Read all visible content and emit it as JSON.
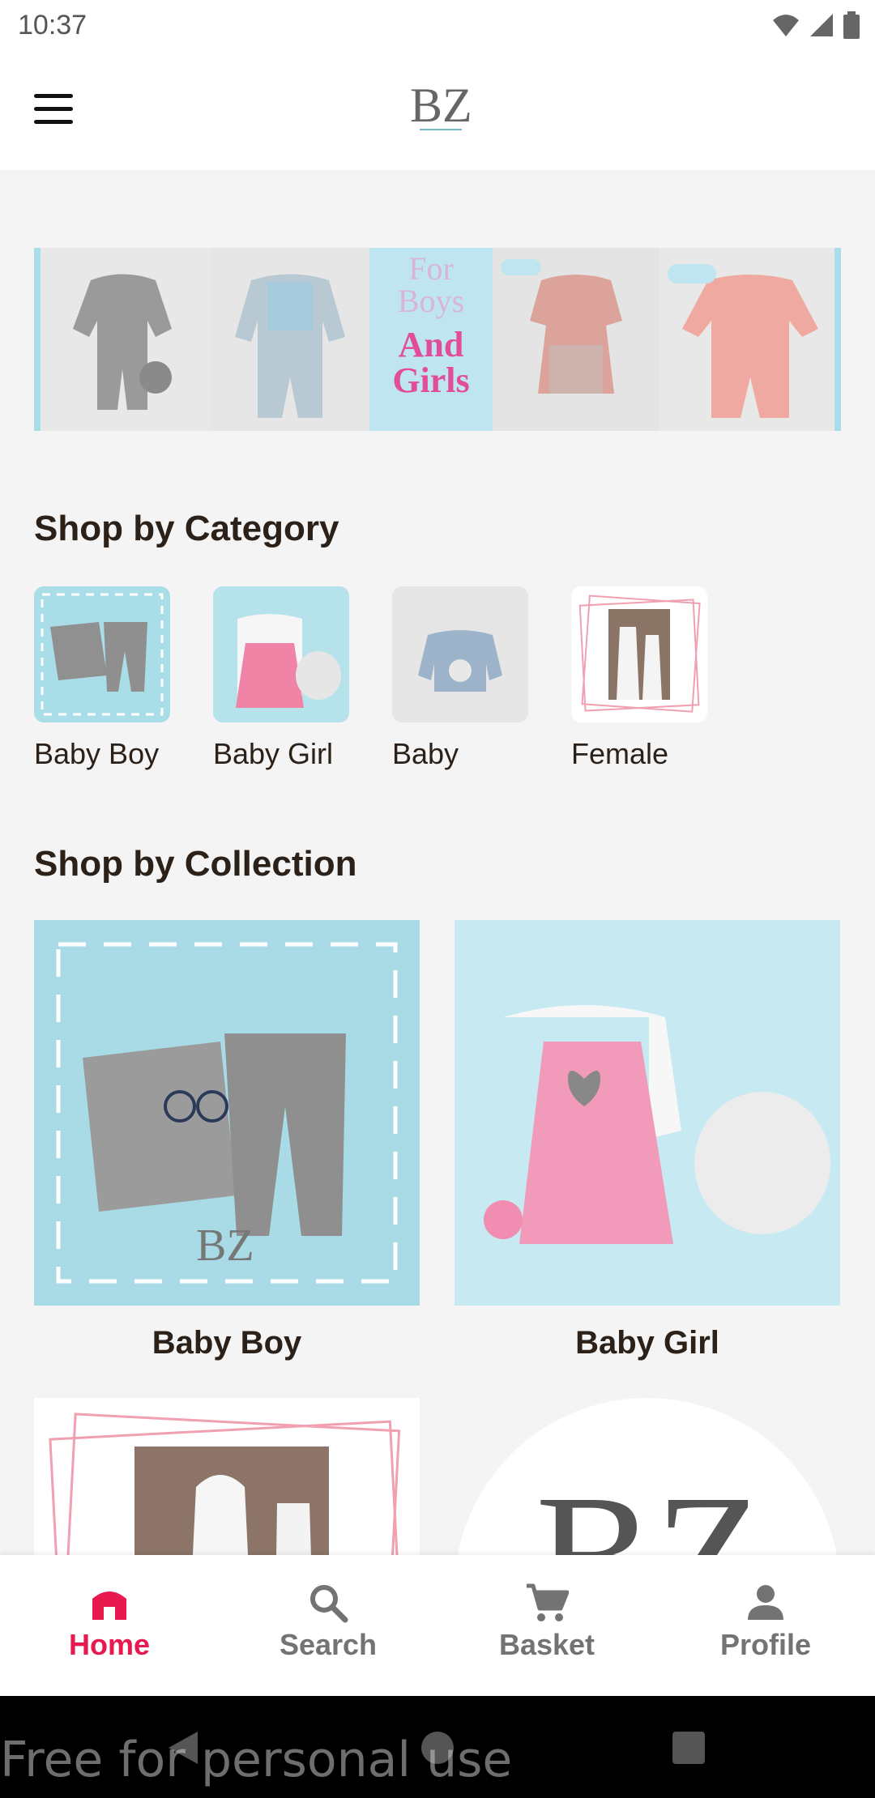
{
  "status_bar": {
    "time": "10:37"
  },
  "app_bar": {
    "logo_text": "BZ"
  },
  "banner": {
    "center_line1": "For",
    "center_line2": "Boys",
    "center_line3": "And",
    "center_line4": "Girls",
    "tag": "BZ"
  },
  "shop_by_category": {
    "title": "Shop by Category",
    "items": [
      {
        "label": "Baby Boy"
      },
      {
        "label": "Baby Girl"
      },
      {
        "label": "Baby"
      },
      {
        "label": "Female"
      }
    ]
  },
  "shop_by_collection": {
    "title": "Shop by Collection",
    "items": [
      {
        "label": "Baby Boy"
      },
      {
        "label": "Baby Girl"
      }
    ],
    "logo_text": "BZ"
  },
  "bottom_nav": {
    "items": [
      {
        "label": "Home",
        "icon": "home-icon",
        "active": true
      },
      {
        "label": "Search",
        "icon": "search-icon",
        "active": false
      },
      {
        "label": "Basket",
        "icon": "cart-icon",
        "active": false
      },
      {
        "label": "Profile",
        "icon": "profile-icon",
        "active": false
      }
    ]
  },
  "watermark": "Free for personal use",
  "colors": {
    "accent": "#e8194f",
    "text": "#2b2118",
    "inactive": "#737373",
    "light_blue": "#a9dde8"
  }
}
